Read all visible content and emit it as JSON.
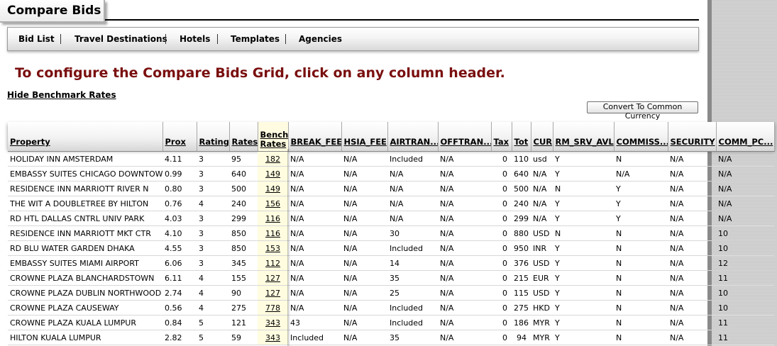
{
  "title": "Compare Bids",
  "nav": [
    "Bid List",
    "Travel Destinations",
    "Hotels",
    "Templates",
    "Agencies"
  ],
  "headline": "To configure the Compare Bids Grid, click on any column header.",
  "hide_link": "Hide Benchmark Rates",
  "convert_button": "Convert To Common Currency",
  "columns": {
    "property": "Property",
    "prox": "Prox",
    "rating": "Rating",
    "rates": "Rates",
    "bench_line1": "Bench",
    "bench_line2": "Rates",
    "break_fee": "BREAK_FEE",
    "hsia_fee": "HSIA_FEE",
    "airtran": "AIRTRAN...",
    "offtran": "OFFTRAN...",
    "tax": "Tax",
    "tot": "Tot",
    "cur": "CUR",
    "rm_srv_avl": "RM_SRV_AVL",
    "commiss": "COMMISS...",
    "security": "SECURITY",
    "comm_pc": "COMM_PC..."
  },
  "rows": [
    [
      "HOLIDAY INN AMSTERDAM",
      "4.11",
      "3",
      "95",
      "182",
      "N/A",
      "N/A",
      "Included",
      "N/A",
      "0",
      "110",
      "usd",
      "Y",
      "N",
      "N/A",
      "N/A"
    ],
    [
      "EMBASSY SUITES CHICAGO DOWNTOWN",
      "0.99",
      "3",
      "640",
      "149",
      "N/A",
      "N/A",
      "N/A",
      "N/A",
      "0",
      "640",
      "N/A",
      "Y",
      "N/A",
      "N/A",
      "N/A"
    ],
    [
      "RESIDENCE INN MARRIOTT RIVER N",
      "0.80",
      "3",
      "500",
      "149",
      "N/A",
      "N/A",
      "N/A",
      "N/A",
      "0",
      "500",
      "N/A",
      "N",
      "Y",
      "N/A",
      "N/A"
    ],
    [
      "THE WIT A DOUBLETREE BY HILTON",
      "0.76",
      "4",
      "240",
      "156",
      "N/A",
      "N/A",
      "N/A",
      "N/A",
      "0",
      "240",
      "N/A",
      "Y",
      "Y",
      "N/A",
      "N/A"
    ],
    [
      "RD HTL DALLAS CNTRL UNIV PARK",
      "4.03",
      "3",
      "299",
      "116",
      "N/A",
      "N/A",
      "N/A",
      "N/A",
      "0",
      "299",
      "N/A",
      "Y",
      "Y",
      "N/A",
      "N/A"
    ],
    [
      "RESIDENCE INN MARRIOTT MKT CTR",
      "4.10",
      "3",
      "850",
      "116",
      "N/A",
      "N/A",
      "30",
      "N/A",
      "0",
      "880",
      "USD",
      "N",
      "N",
      "N/A",
      "10"
    ],
    [
      "RD BLU WATER GARDEN DHAKA",
      "4.55",
      "3",
      "850",
      "153",
      "N/A",
      "N/A",
      "Included",
      "N/A",
      "0",
      "950",
      "INR",
      "Y",
      "N",
      "N/A",
      "10"
    ],
    [
      "EMBASSY SUITES MIAMI AIRPORT",
      "6.06",
      "3",
      "345",
      "112",
      "N/A",
      "N/A",
      "14",
      "N/A",
      "0",
      "376",
      "USD",
      "Y",
      "N",
      "N/A",
      "12"
    ],
    [
      "CROWNE PLAZA BLANCHARDSTOWN",
      "6.11",
      "4",
      "155",
      "127",
      "N/A",
      "N/A",
      "35",
      "N/A",
      "0",
      "215",
      "EUR",
      "Y",
      "N",
      "N/A",
      "11"
    ],
    [
      "CROWNE PLAZA DUBLIN NORTHWOOD",
      "2.74",
      "4",
      "90",
      "127",
      "N/A",
      "N/A",
      "25",
      "N/A",
      "0",
      "115",
      "USD",
      "Y",
      "N",
      "N/A",
      "10"
    ],
    [
      "CROWNE PLAZA CAUSEWAY",
      "0.56",
      "4",
      "275",
      "778",
      "N/A",
      "N/A",
      "Included",
      "N/A",
      "0",
      "275",
      "HKD",
      "Y",
      "N",
      "N/A",
      "10"
    ],
    [
      "CROWNE PLAZA KUALA LUMPUR",
      "0.84",
      "5",
      "121",
      "343",
      "43",
      "N/A",
      "Included",
      "N/A",
      "0",
      "186",
      "MYR",
      "Y",
      "N",
      "N/A",
      "11"
    ],
    [
      "HILTON KUALA LUMPUR",
      "2.82",
      "5",
      "59",
      "343",
      "Included",
      "N/A",
      "35",
      "N/A",
      "0",
      "94",
      "MYR",
      "Y",
      "N",
      "N/A",
      "11"
    ]
  ],
  "colors": {
    "headline": "#7a0f0f",
    "bench_bg": "#fffce0",
    "gutter": "#cfcfcf"
  }
}
